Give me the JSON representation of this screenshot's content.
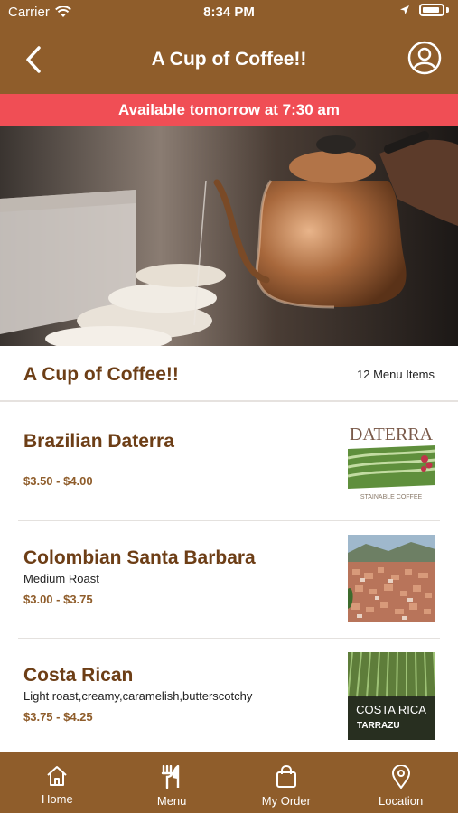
{
  "status_bar": {
    "carrier": "Carrier",
    "time": "8:34 PM",
    "icons": [
      "wifi-icon",
      "location-arrow-icon",
      "battery-icon"
    ]
  },
  "header": {
    "title": "A Cup of Coffee!!",
    "back_icon": "chevron-left-icon",
    "account_icon": "user-circle-icon"
  },
  "banner": {
    "text": "Available tomorrow at 7:30 am"
  },
  "store": {
    "name": "A Cup of Coffee!!",
    "item_count": "12 Menu Items"
  },
  "menu": [
    {
      "name": "Brazilian Daterra",
      "description": "",
      "price": "$3.50 - $4.00",
      "thumb_text_top": "DATERRA",
      "thumb_text_bottom": "STAINABLE COFFEE"
    },
    {
      "name": "Colombian Santa Barbara",
      "description": "Medium Roast",
      "price": "$3.00 - $3.75"
    },
    {
      "name": "Costa Rican",
      "description": "Light roast,creamy,caramelish,butterscotchy",
      "price": "$3.75 - $4.25",
      "thumb_text_top": "COSTA RICA",
      "thumb_text_bottom": "TARRAZU"
    }
  ],
  "tabs": [
    {
      "label": "Home",
      "icon": "home-icon"
    },
    {
      "label": "Menu",
      "icon": "fork-knife-icon"
    },
    {
      "label": "My Order",
      "icon": "shopping-bag-icon"
    },
    {
      "label": "Location",
      "icon": "map-pin-icon"
    }
  ],
  "colors": {
    "primary": "#8f5d2b",
    "banner": "#f04e55",
    "text_brown": "#6d3e16"
  }
}
